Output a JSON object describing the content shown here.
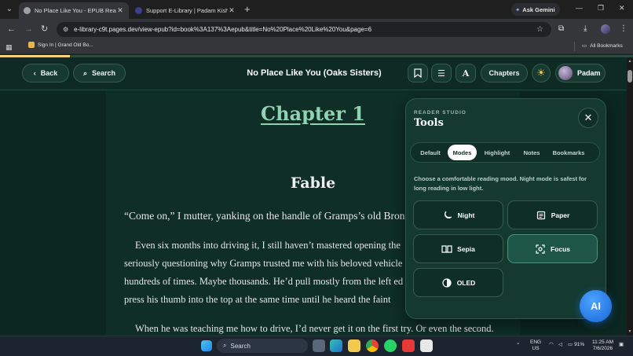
{
  "browser": {
    "tabs": [
      {
        "title": "No Place Like You - EPUB Reader",
        "active": true
      },
      {
        "title": "Support E-Library | Padam Kishore",
        "active": false
      }
    ],
    "gemini_label": "Ask Gemini",
    "url": "e-library-c9t.pages.dev/view-epub?id=book%3A137%3Aepub&title=No%20Place%20Like%20You&page=6",
    "bookmarks": {
      "item": "Sign In | Grand Old Bo...",
      "all": "All Bookmarks"
    }
  },
  "reader": {
    "progress": 0.11,
    "back_label": "Back",
    "search_label": "Search",
    "book_title": "No Place Like You (Oaks Sisters)",
    "chapters_label": "Chapters",
    "user_name": "Padam",
    "chapter_heading": "Chapter 1",
    "section_heading": "Fable",
    "paragraphs": [
      "“Come on,” I mutter, yanking on the handle of Gramps’s old Bronco",
      "Even six months into driving it, I still haven’t mastered opening the",
      "seriously questioning why Gramps trusted me with his beloved vehicle",
      "hundreds of times. Maybe thousands. He’d pull mostly from the left ed",
      "press his thumb into the top at the same time until he heard the faint",
      "When he was teaching me how to drive, I’d never get it on the first try. Or even the second."
    ]
  },
  "tools_panel": {
    "eyebrow": "READER STUDIO",
    "title": "Tools",
    "tabs": [
      "Default",
      "Modes",
      "Highlight",
      "Notes",
      "Bookmarks"
    ],
    "active_tab": "Modes",
    "hint": "Choose a comfortable reading mood. Night mode is safest for long reading in low light.",
    "modes": [
      {
        "label": "Night",
        "icon": "moon-icon"
      },
      {
        "label": "Paper",
        "icon": "document-icon"
      },
      {
        "label": "Sepia",
        "icon": "book-icon"
      },
      {
        "label": "Focus",
        "icon": "focus-icon"
      },
      {
        "label": "OLED",
        "icon": "contrast-icon"
      }
    ],
    "selected_mode": "Focus"
  },
  "ai_label": "AI",
  "taskbar": {
    "search": "Search",
    "lang": "ENG",
    "region": "US",
    "battery": "91%",
    "time": "11:25 AM",
    "date": "7/6/2026"
  },
  "colors": {
    "background": "#0d2a22",
    "chapter_accent": "#8fd3b3",
    "ai_button": "#1767d6"
  }
}
